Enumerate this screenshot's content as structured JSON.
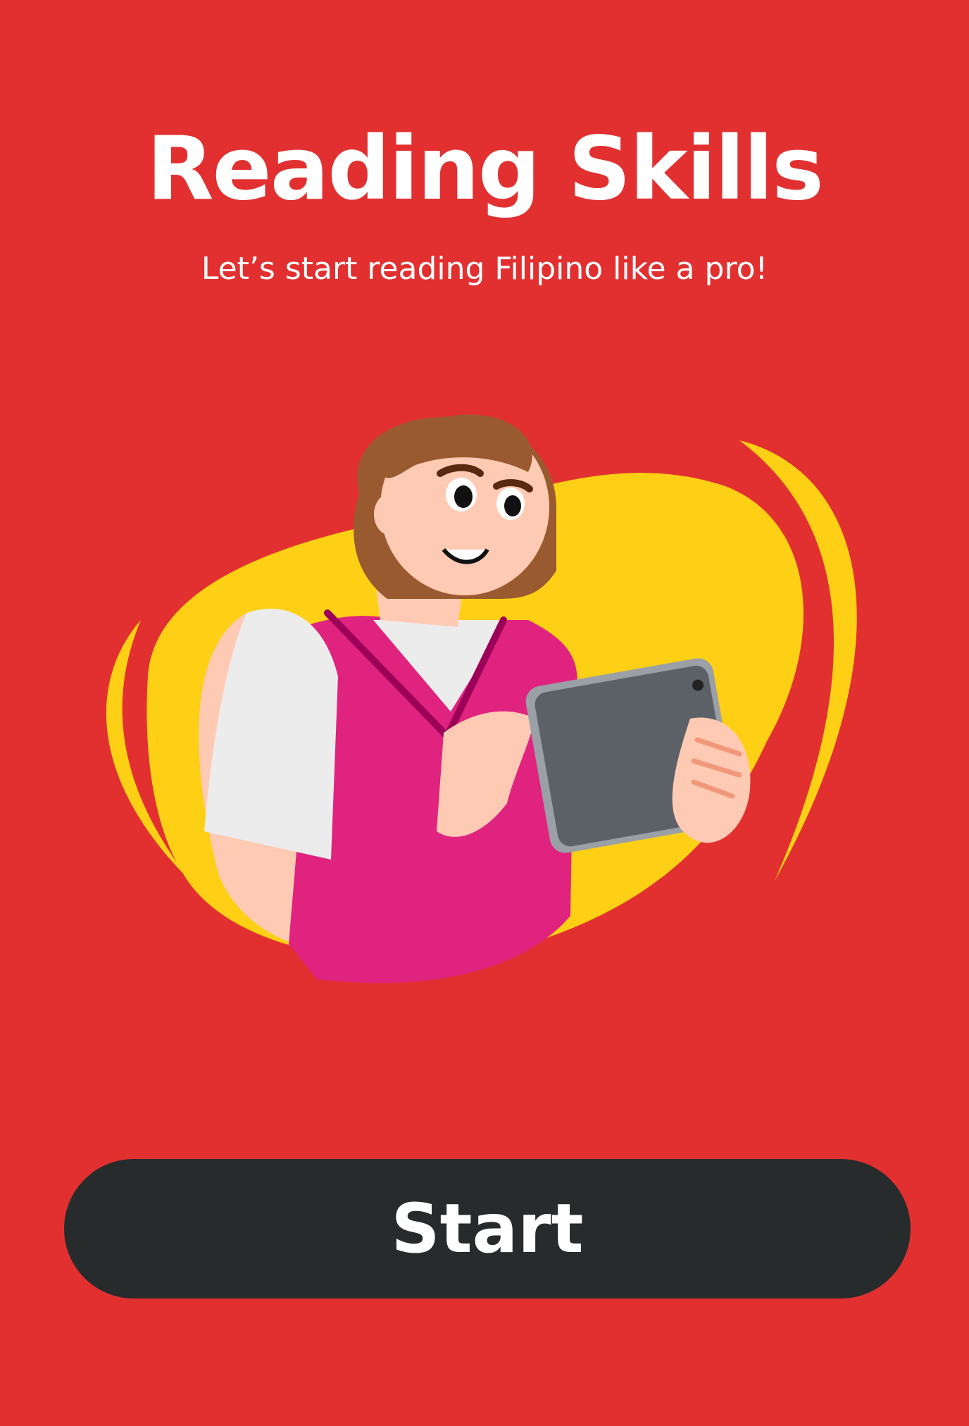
{
  "screen": {
    "title": "Reading Skills",
    "subtitle": "Let’s start reading Filipino like a pro!",
    "start_label": "Start"
  },
  "colors": {
    "background": "#e23030",
    "accent_yellow": "#fdd016",
    "button": "#272b2c",
    "text": "#ffffff"
  },
  "illustration": {
    "icon": "girl-reading-tablet-illustration"
  }
}
